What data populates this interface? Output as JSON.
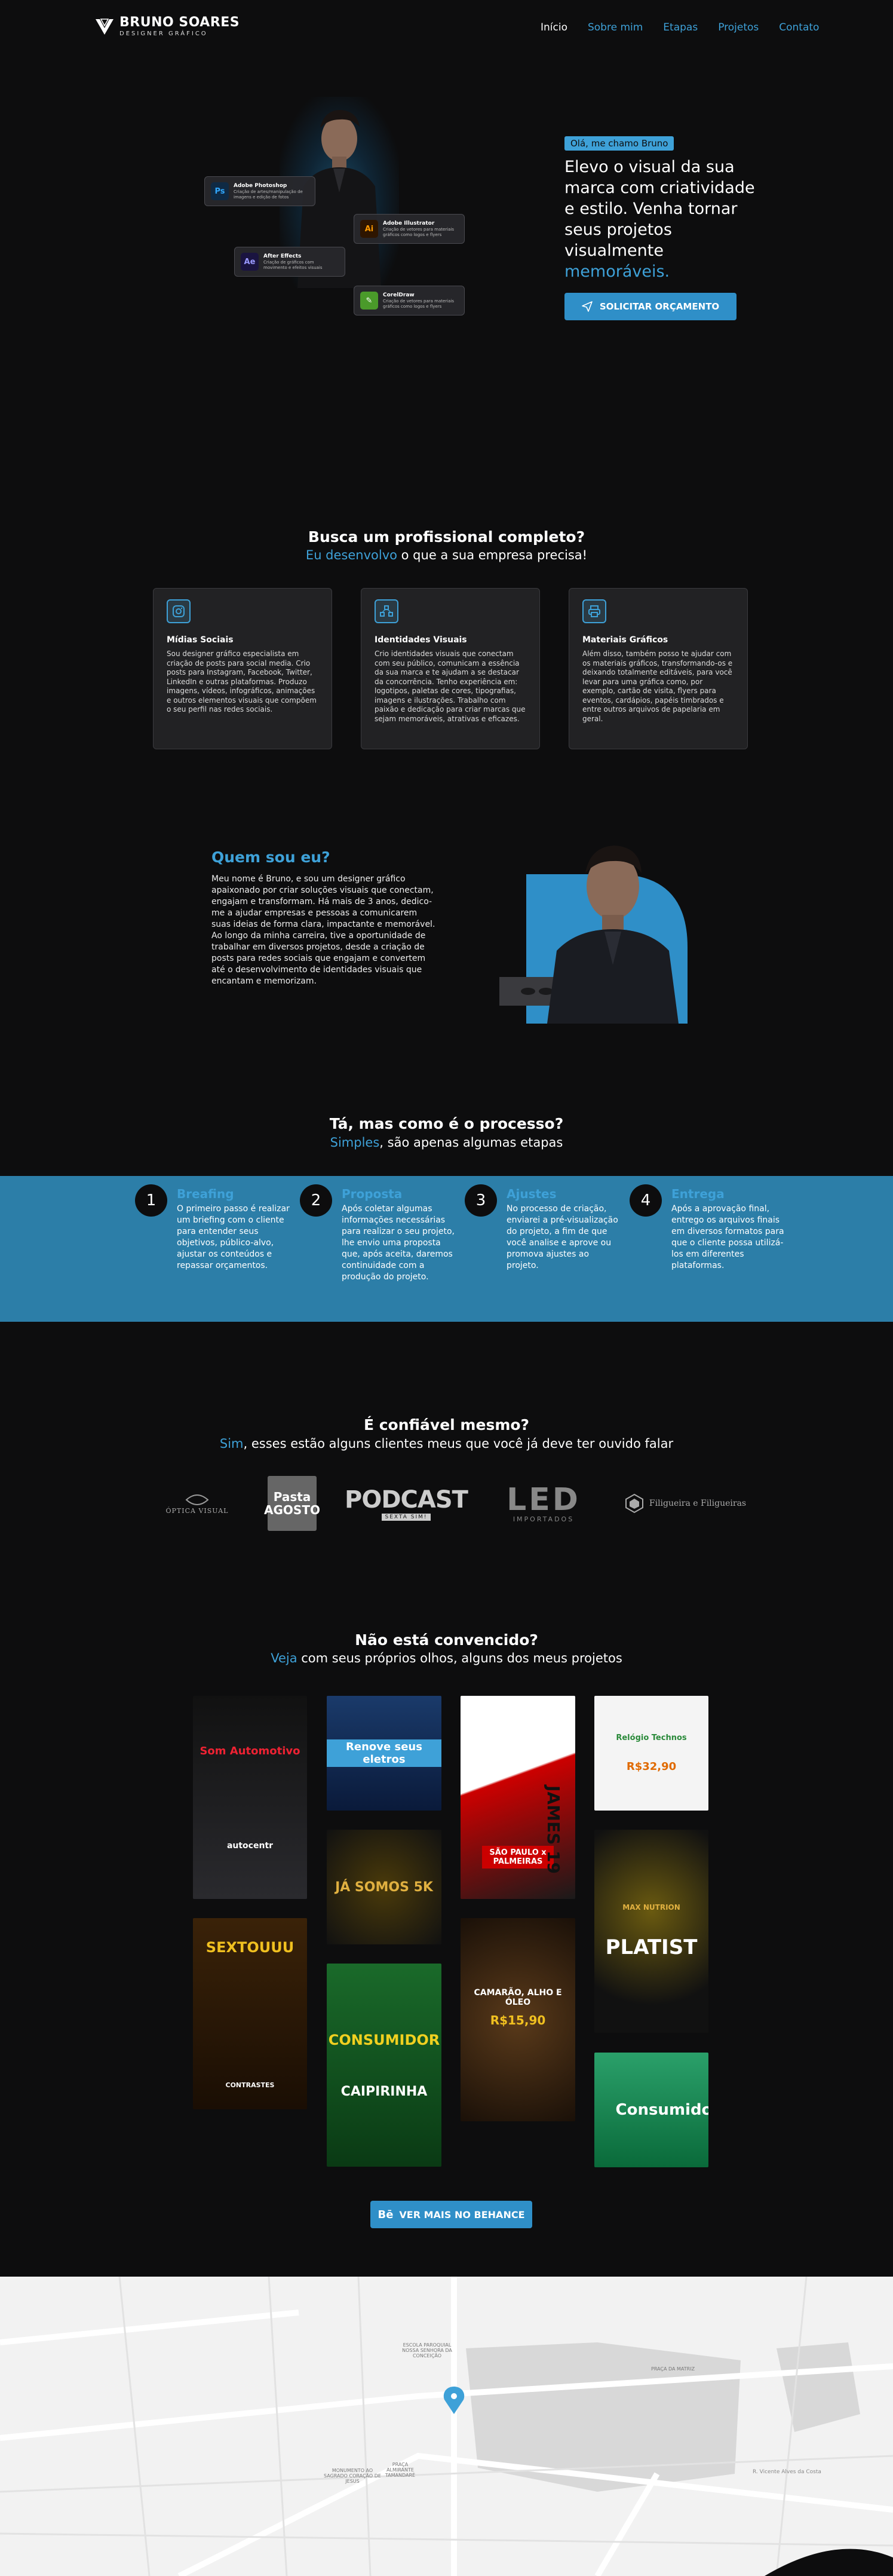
{
  "brand": {
    "name": "BRUNO SOARES",
    "subtitle": "DESIGNER GRÁFICO"
  },
  "nav": {
    "items": [
      "Início",
      "Sobre mim",
      "Etapas",
      "Projetos",
      "Contato"
    ]
  },
  "hero": {
    "tag": "Olá, me chamo Bruno",
    "title_main": "Elevo o visual da sua marca com criatividade e estilo. Venha tornar seus projetos visualmente",
    "title_accent": "memoráveis.",
    "cta": "SOLICITAR ORÇAMENTO",
    "tools": [
      {
        "abbr": "Ps",
        "name": "Adobe Photoshop",
        "desc": "Criação de artes/manipulação de imagens e edição de fotos"
      },
      {
        "abbr": "Ai",
        "name": "Adobe Illustrator",
        "desc": "Criação de vetores para materiais gráficos como logos e flyers"
      },
      {
        "abbr": "Ae",
        "name": "After Effects",
        "desc": "Criação de gráficos com movimento e efeitos visuais"
      },
      {
        "abbr": "Cd",
        "name": "CorelDraw",
        "desc": "Criação de vetores para materiais gráficos como logos e flyers"
      }
    ]
  },
  "services": {
    "title": "Busca um profissional completo?",
    "sub_accent": "Eu desenvolvo",
    "sub_rest": " o que a sua empresa precisa!",
    "cards": [
      {
        "icon": "instagram-icon",
        "title": "Mídias Sociais",
        "text": "Sou designer gráfico especialista em criação de posts para social media. Crio posts para Instagram, Facebook, Twitter, LinkedIn e outras plataformas. Produzo imagens, vídeos, infográficos, animações e outros elementos visuais que compõem o seu perfil nas redes sociais."
      },
      {
        "icon": "vector-icon",
        "title": "Identidades Visuais",
        "text": "Crio identidades visuais que conectam com seu público, comunicam a essência da sua marca e te ajudam a se destacar da concorrência. Tenho experiência em: logotipos, paletas de cores, tipografias, imagens e ilustrações. Trabalho com paixão e dedicação para criar marcas que sejam memoráveis, atrativas e eficazes."
      },
      {
        "icon": "printer-icon",
        "title": "Materiais Gráficos",
        "text": "Além disso, também posso te ajudar com os materiais gráficos, transformando-os e deixando totalmente editáveis, para você levar para uma gráfica como, por exemplo, cartão de visita, flyers para eventos, cardápios, papéis timbrados e entre outros arquivos de papelaria em geral."
      }
    ]
  },
  "about": {
    "title": "Quem sou eu?",
    "text": "Meu nome é Bruno, e sou um designer gráfico apaixonado por criar soluções visuais que conectam, engajam e transformam. Há mais de 3 anos, dedico-me a ajudar empresas e pessoas a comunicarem suas ideias de forma clara, impactante e memorável. Ao longo da minha carreira, tive a oportunidade de trabalhar em diversos projetos, desde a criação de posts para redes sociais que engajam e convertem até o desenvolvimento de identidades visuais que encantam e memorizam."
  },
  "process": {
    "title": "Tá, mas como é o processo?",
    "sub_accent": "Simples",
    "sub_rest": ", são apenas algumas etapas",
    "steps": [
      {
        "num": "1",
        "title": "Breafing",
        "text": "O primeiro passo é realizar um briefing com o cliente para entender seus objetivos, público-alvo, ajustar os conteúdos e repassar orçamentos."
      },
      {
        "num": "2",
        "title": "Proposta",
        "text": "Após coletar algumas informações necessárias para realizar o seu projeto, lhe envio uma proposta que, após aceita, daremos continuidade com a produção do projeto."
      },
      {
        "num": "3",
        "title": "Ajustes",
        "text": "No processo de criação, enviarei a pré-visualização do projeto, a fim de que você analise e aprove ou promova ajustes ao projeto."
      },
      {
        "num": "4",
        "title": "Entrega",
        "text": "Após a aprovação final, entrego os arquivos finais em diversos formatos para que o cliente possa utilizá-los em diferentes plataformas."
      }
    ]
  },
  "clients": {
    "title": "É confiável mesmo?",
    "sub_accent": "Sim",
    "sub_rest": ", esses estão alguns clientes meus que você já deve ter ouvido falar",
    "logos": [
      {
        "name": "ÓPTICA VISUAL"
      },
      {
        "name": "Pasta AGOSTO"
      },
      {
        "name": "PODCAST",
        "tag": "SEXTA SIM!"
      },
      {
        "name": "LED",
        "tag": "IMPORTADOS"
      },
      {
        "name": "Filigueira e Filigueiras"
      }
    ]
  },
  "portfolio": {
    "title": "Não está convencido?",
    "sub_accent": "Veja",
    "sub_rest": " com seus próprios olhos, alguns dos meus projetos",
    "items": [
      {
        "caption": "Som Automotivo",
        "brand": "autocentr"
      },
      {
        "caption": "Renove seus eletros",
        "brand": ""
      },
      {
        "caption": "SÃO PAULO x PALMEIRAS",
        "brand": "JAMES 19"
      },
      {
        "caption": "Relógio Technos",
        "brand": "R$32,90"
      },
      {
        "caption": "JÁ SOMOS 5K",
        "brand": ""
      },
      {
        "caption": "PLATIST",
        "brand": "MAX NUTRION"
      },
      {
        "caption": "SEXTOUUU",
        "brand": "CONTRASTES"
      },
      {
        "caption": "CAMARÃO, ALHO E ÓLEO",
        "brand": "R$15,90"
      },
      {
        "caption": "CONSUMIDOR",
        "brand": "CAIPIRINHA"
      },
      {
        "caption": "Consumidor",
        "brand": ""
      }
    ],
    "cta": "VER MAIS NO BEHANCE"
  },
  "map": {
    "labels": [
      "ESCOLA PAROQUIAL NOSSA SENHORA DA CONCEIÇÃO",
      "PRAÇA DA MATRIZ",
      "MONUMENTO AO SAGRADO CORAÇÃO DE JESUS",
      "PRAÇA ALMIRANTE TAMANDARÉ",
      "R. Vicente Alves da Costa"
    ]
  }
}
